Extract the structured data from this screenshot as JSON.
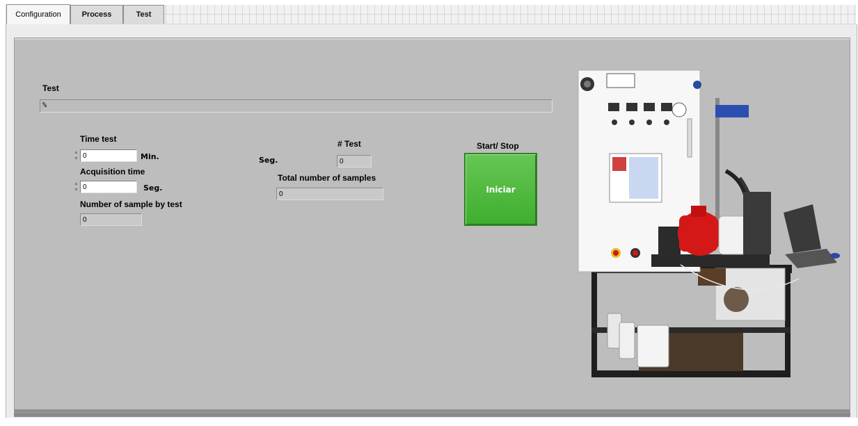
{
  "tabs": [
    {
      "label": "Configuration",
      "active": true
    },
    {
      "label": "Process",
      "active": false
    },
    {
      "label": "Test",
      "active": false
    }
  ],
  "test_section": {
    "label": "Test",
    "progress_text": "%",
    "progress_fraction": 0
  },
  "time_test": {
    "label": "Time test",
    "value": "0",
    "unit": "Min."
  },
  "acquisition_time": {
    "label": "Acquisition time",
    "value": "0",
    "unit": "Seg."
  },
  "samples_by_test": {
    "label": "Number of sample by test",
    "value": "0"
  },
  "seg_label": "Seg.",
  "test_count": {
    "label": "# Test",
    "value": "0"
  },
  "total_samples": {
    "label": "Total number of samples",
    "value": "0"
  },
  "start_stop": {
    "label": "Start/ Stop",
    "button_label": "Iniciar",
    "color": "#4cb83a"
  },
  "icons": {
    "spinner": "spin-arrows-icon",
    "photo": "test-bench-photo"
  }
}
